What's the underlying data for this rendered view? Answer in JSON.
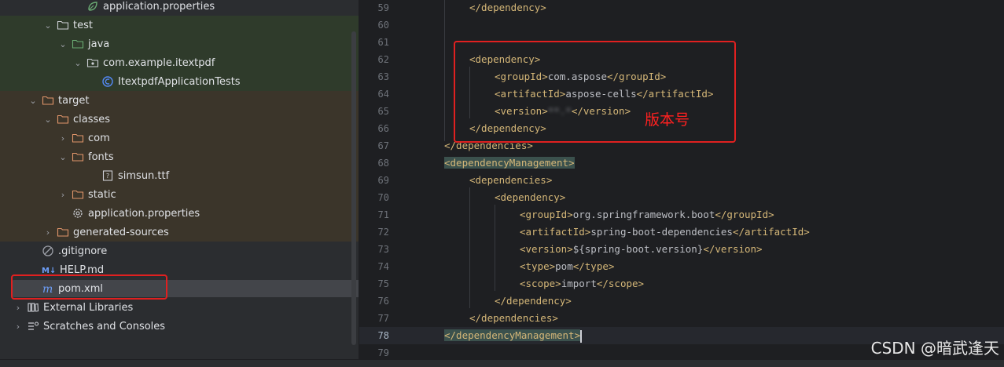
{
  "project_tree": {
    "items": [
      {
        "label": "application.properties",
        "icon": "spring-properties-icon"
      },
      {
        "label": "test",
        "icon": "folder-icon"
      },
      {
        "label": "java",
        "icon": "test-source-folder-icon"
      },
      {
        "label": "com.example.itextpdf",
        "icon": "package-icon"
      },
      {
        "label": "ItextpdfApplicationTests",
        "icon": "test-class-icon"
      },
      {
        "label": "target",
        "icon": "folder-icon"
      },
      {
        "label": "classes",
        "icon": "folder-icon"
      },
      {
        "label": "com",
        "icon": "folder-icon"
      },
      {
        "label": "fonts",
        "icon": "folder-icon"
      },
      {
        "label": "simsun.ttf",
        "icon": "font-file-icon"
      },
      {
        "label": "static",
        "icon": "folder-icon"
      },
      {
        "label": "application.properties",
        "icon": "gear-properties-icon"
      },
      {
        "label": "generated-sources",
        "icon": "folder-icon"
      },
      {
        "label": ".gitignore",
        "icon": "gitignore-icon"
      },
      {
        "label": "HELP.md",
        "icon": "markdown-icon"
      },
      {
        "label": "pom.xml",
        "icon": "maven-icon"
      },
      {
        "label": "External Libraries",
        "icon": "library-icon"
      },
      {
        "label": "Scratches and Consoles",
        "icon": "scratches-icon"
      }
    ]
  },
  "editor": {
    "line_numbers": [
      "59",
      "60",
      "61",
      "62",
      "63",
      "64",
      "65",
      "66",
      "67",
      "68",
      "69",
      "70",
      "71",
      "72",
      "73",
      "74",
      "75",
      "76",
      "77",
      "78",
      "79"
    ],
    "current_line": "78",
    "code": {
      "l59": [
        "</dependency>"
      ],
      "l62": [
        "<dependency>"
      ],
      "l63": [
        "<groupId>",
        "com.aspose",
        "</groupId>"
      ],
      "l64": [
        "<artifactId>",
        "aspose-cells",
        "</artifactId>"
      ],
      "l65": [
        "<version>",
        "**.*",
        "</version>"
      ],
      "l66": [
        "</dependency>"
      ],
      "l67": [
        "</dependencies>"
      ],
      "l68": [
        "<dependencyManagement>"
      ],
      "l69": [
        "<dependencies>"
      ],
      "l70": [
        "<dependency>"
      ],
      "l71": [
        "<groupId>",
        "org.springframework.boot",
        "</groupId>"
      ],
      "l72": [
        "<artifactId>",
        "spring-boot-dependencies",
        "</artifactId>"
      ],
      "l73": [
        "<version>",
        "${spring-boot.version}",
        "</version>"
      ],
      "l74": [
        "<type>",
        "pom",
        "</type>"
      ],
      "l75": [
        "<scope>",
        "import",
        "</scope>"
      ],
      "l76": [
        "</dependency>"
      ],
      "l77": [
        "</dependencies>"
      ],
      "l78": [
        "</dependencyManagement>"
      ]
    }
  },
  "annotation": {
    "label": "版本号",
    "color": "#ff2020"
  },
  "watermark": "CSDN @暗武逢天",
  "colors": {
    "tag": "#d5b778",
    "text": "#bcbec4",
    "test_band": "#2f3b2b",
    "target_band": "#3b352a",
    "highlight": "#e02020"
  }
}
